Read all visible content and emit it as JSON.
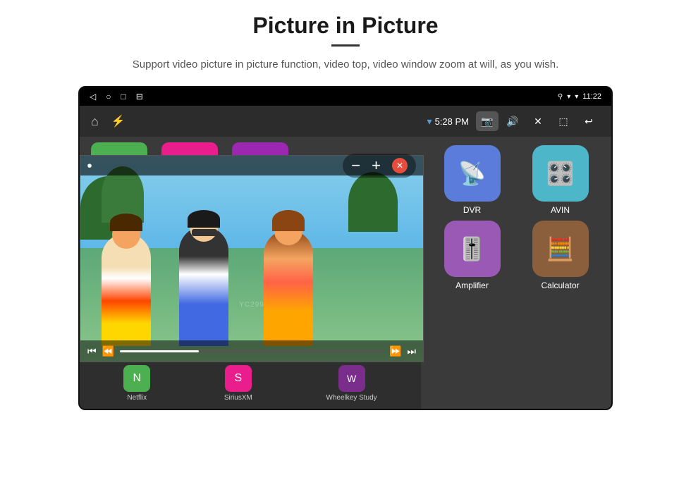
{
  "header": {
    "title": "Picture in Picture",
    "subtitle": "Support video picture in picture function, video top, video window zoom at will, as you wish."
  },
  "toolbar": {
    "time": "5:28 PM",
    "status_time": "11:22"
  },
  "apps": {
    "dvr_label": "DVR",
    "avin_label": "AVIN",
    "amplifier_label": "Amplifier",
    "calculator_label": "Calculator",
    "netflix_label": "Netflix",
    "siriusxm_label": "SiriusXM",
    "wheelkey_label": "Wheelkey Study"
  },
  "icons": {
    "back": "◁",
    "home_android": "○",
    "square": "□",
    "menu": "⊟",
    "location": "⚲",
    "wifi": "▾",
    "signal": "▾",
    "home": "⌂",
    "usb": "⚡",
    "volume": "🔊",
    "close_x": "✕",
    "pip_frame": "⬚",
    "undo": "↩",
    "camera": "📷",
    "record_circle": "⏺",
    "prev": "⏮",
    "next": "⏭",
    "play": "▶",
    "rewind": "⏪",
    "forward": "⏩",
    "minus": "−",
    "plus": "+",
    "close_circle": "⊗"
  }
}
